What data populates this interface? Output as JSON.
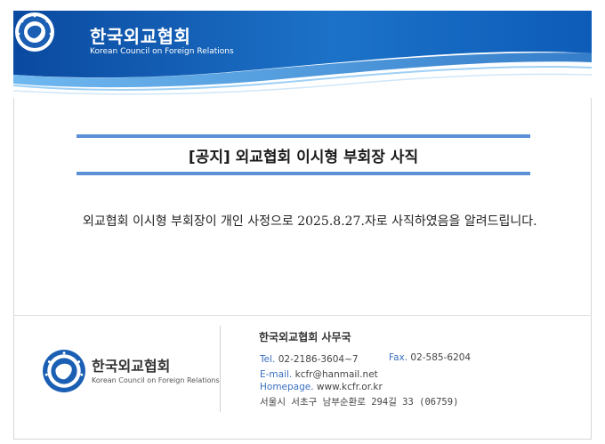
{
  "header": {
    "org_name_ko": "한국외교협회",
    "org_name_en": "Korean Council on Foreign Relations",
    "logo_icon": "globe-emblem-icon"
  },
  "notice": {
    "title": "[공지] 외교협회 이시형 부회장 사직",
    "body": "외교협회 이시형 부회장이 개인 사정으로 2025.8.27.자로 사직하였음을 알려드립니다."
  },
  "footer": {
    "org_name_ko": "한국외교협회",
    "org_name_en": "Korean Council on Foreign Relations",
    "office": "한국외교협회 사무국",
    "tel_label": "Tel.",
    "tel": "02-2186-3604~7",
    "fax_label": "Fax.",
    "fax": "02-585-6204",
    "email_label": "E-mail.",
    "email": "kcfr@hanmail.net",
    "homepage_label": "Homepage.",
    "homepage": "www.kcfr.or.kr",
    "address": "서울시 서초구 남부순환로 294길 33 (06759)"
  },
  "colors": {
    "banner_dark": "#0b4fa8",
    "banner_light": "#2a86d6",
    "accent_line": "#5b8fd6",
    "label_blue": "#3a6fc0"
  }
}
